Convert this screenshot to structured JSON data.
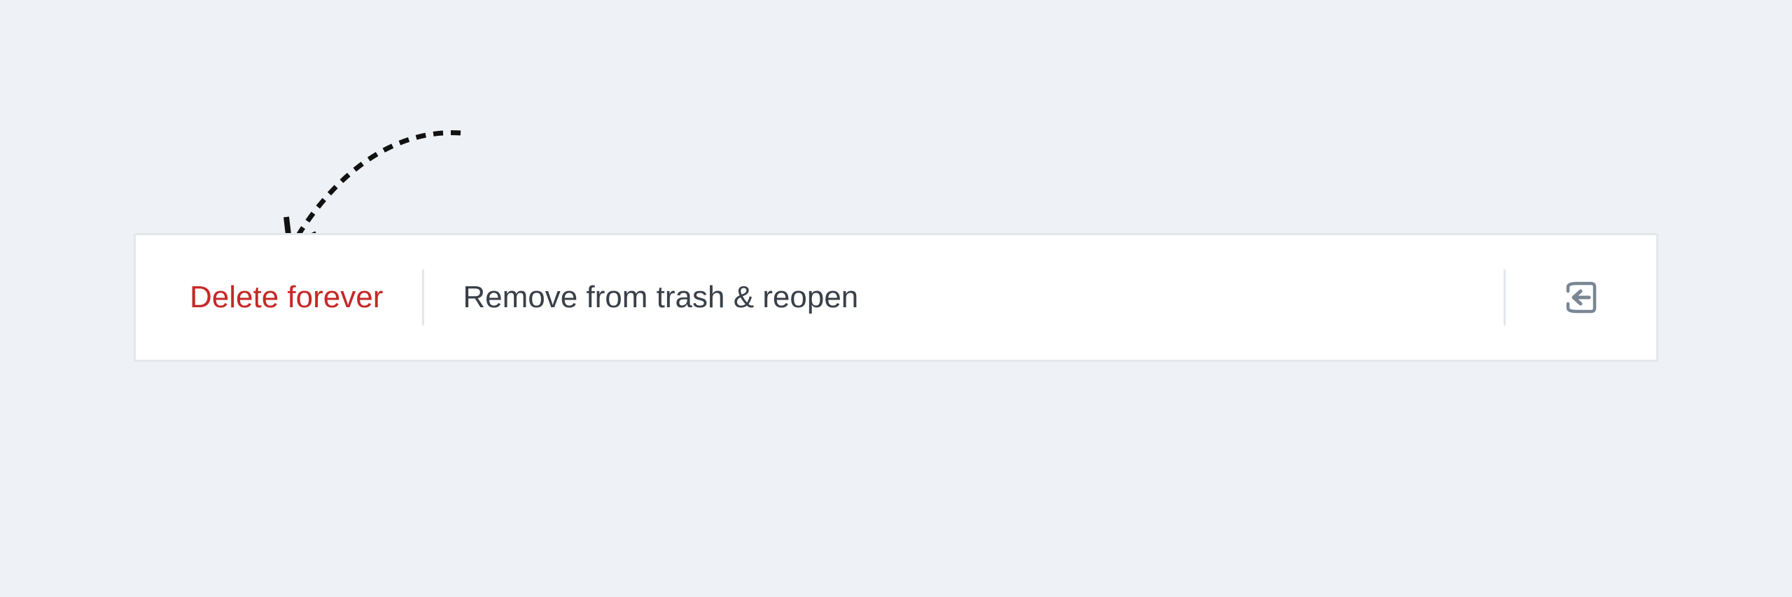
{
  "toolbar": {
    "delete_label": "Delete forever",
    "restore_label": "Remove from trash & reopen",
    "exit_icon": "exit-icon"
  },
  "annotation": {
    "icon": "dashed-curved-arrow-icon"
  },
  "colors": {
    "background": "#eef1f5",
    "toolbar_bg": "#ffffff",
    "border": "#e3e7ec",
    "delete_text": "#c62828",
    "primary_text": "#3a4049",
    "icon": "#7a8694",
    "arrow": "#111111"
  }
}
